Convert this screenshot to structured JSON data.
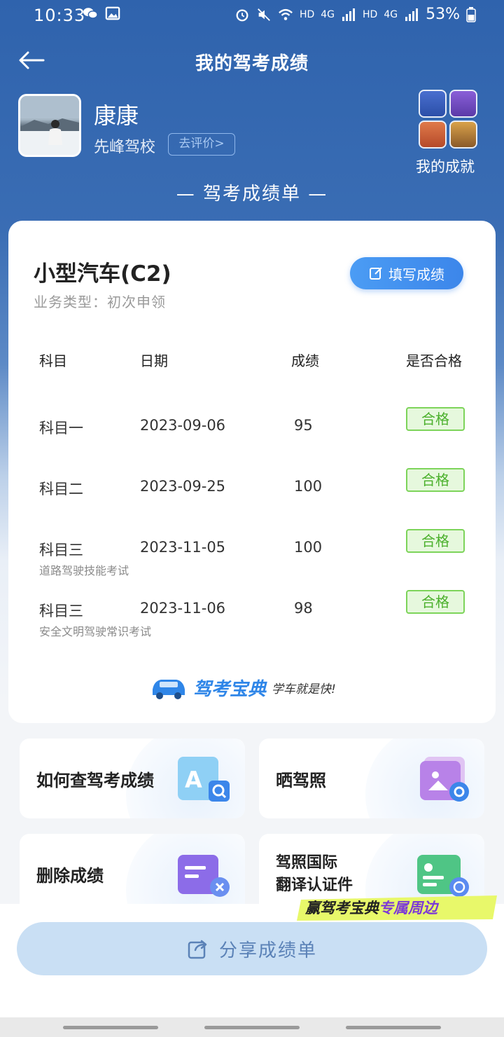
{
  "status_bar": {
    "time": "10:33",
    "network_labels": [
      "HD",
      "4G",
      "HD",
      "4G"
    ],
    "battery": "53%"
  },
  "header": {
    "title": "我的驾考成绩"
  },
  "profile": {
    "name": "康康",
    "school": "先峰驾校",
    "rate_label": "去评价>",
    "achievements_label": "我的成就"
  },
  "section_title": "— 驾考成绩单 —",
  "scorecard": {
    "car_type": "小型汽车(C2)",
    "business_type": "业务类型：初次申领",
    "fill_button": "填写成绩",
    "columns": [
      "科目",
      "日期",
      "成绩",
      "是否合格"
    ],
    "rows": [
      {
        "subject": "科目一",
        "sub": "",
        "date": "2023-09-06",
        "score": "95",
        "status": "合格"
      },
      {
        "subject": "科目二",
        "sub": "",
        "date": "2023-09-25",
        "score": "100",
        "status": "合格"
      },
      {
        "subject": "科目三",
        "sub": "道路驾驶技能考试",
        "date": "2023-11-05",
        "score": "100",
        "status": "合格"
      },
      {
        "subject": "科目三",
        "sub": "安全文明驾驶常识考试",
        "date": "2023-11-06",
        "score": "98",
        "status": "合格"
      }
    ],
    "brand_name": "驾考宝典",
    "brand_slogan": "学车就是快!"
  },
  "tiles": [
    {
      "label": "如何查驾考成绩",
      "icon": "search-document-icon"
    },
    {
      "label": "晒驾照",
      "icon": "photo-camera-icon"
    },
    {
      "label": "删除成绩",
      "icon": "delete-document-icon"
    },
    {
      "label_line1": "驾照国际",
      "label_line2": "翻译认证件",
      "icon": "translate-card-icon"
    }
  ],
  "promo": {
    "text_part1": "赢驾考宝典",
    "text_part2": "专属周边"
  },
  "share_button": "分享成绩单",
  "colors": {
    "primary_blue": "#2f63ad",
    "pass_green": "#4bb02c",
    "button_blue": "#3c86ea"
  }
}
